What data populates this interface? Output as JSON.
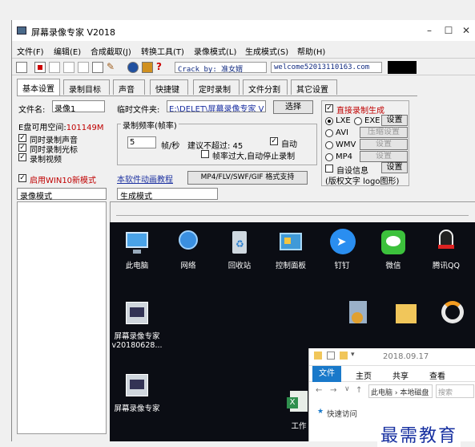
{
  "window": {
    "title": "屏幕录像专家 V2018"
  },
  "menu": [
    "文件(F)",
    "编辑(E)",
    "合成截取(J)",
    "转换工具(T)",
    "录像模式(L)",
    "生成模式(S)",
    "帮助(H)"
  ],
  "toolbar": {
    "crack_text": "Crack by: 准女婿",
    "email_text": "welcome52013110163.com"
  },
  "tabs": [
    "基本设置",
    "录制目标",
    "声音",
    "快捷键",
    "定时录制",
    "文件分割",
    "其它设置"
  ],
  "basic": {
    "filename_label": "文件名:",
    "filename_value": "录像1",
    "tempdir_label": "临时文件夹:",
    "tempdir_value": "E:\\DELET\\屏幕录像专家 V",
    "select_button": "选择",
    "free_space_label": "E盘可用空间:",
    "free_space_value": "101149M",
    "checks": [
      "同时录制声音",
      "同时录制光标",
      "录制视频"
    ],
    "win10_mode": "启用WIN10新模式",
    "tutorial_link": "本软件动画教程",
    "format_button": "MP4/FLV/SWF/GIF  格式支持"
  },
  "frequency": {
    "group_title": "录制频率(帧率)",
    "fps_value": "5",
    "fps_unit": "帧/秒",
    "suggest_text": "建议不超过: 45",
    "auto_label": "自动",
    "auto_stop_label": "帧率过大,自动停止录制"
  },
  "generate": {
    "direct_label": "直接录制生成",
    "formats": [
      {
        "label": "LXE",
        "alt": "EXE",
        "button": "设置",
        "dim": false
      },
      {
        "label": "AVI",
        "button": "压缩设置",
        "dim": true
      },
      {
        "label": "WMV",
        "button": "设置",
        "dim": true
      },
      {
        "label": "MP4",
        "button": "设置",
        "dim": true
      }
    ],
    "auto_info_label": "自设信息",
    "auto_info_button": "设置",
    "copyright_text": "(版权文字 logo图形)"
  },
  "modes": {
    "record_mode": "录像模式",
    "generate_mode": "生成模式"
  },
  "desktop_icons": [
    {
      "label": "此电脑",
      "icon": "computer-icon",
      "color": "#4aa3e8"
    },
    {
      "label": "网络",
      "icon": "network-icon",
      "color": "#3a8fe0"
    },
    {
      "label": "回收站",
      "icon": "recycle-bin-icon",
      "color": "#cfd8e0"
    },
    {
      "label": "控制面板",
      "icon": "control-panel-icon",
      "color": "#3f9ad8"
    },
    {
      "label": "钉钉",
      "icon": "dingtalk-icon",
      "color": "#2a8ef0"
    },
    {
      "label": "微信",
      "icon": "wechat-icon",
      "color": "#3cc13c"
    },
    {
      "label": "腾讯QQ",
      "icon": "qq-icon",
      "color": "#f2f2f2"
    }
  ],
  "desktop_icons_row2": [
    {
      "label": "屏幕录像专家\nv20180628...",
      "icon": "recorder-app-icon",
      "color": "#d0d6dd"
    },
    {
      "label": "屏幕录像专家",
      "icon": "recorder-app-icon",
      "color": "#d0d6dd"
    },
    {
      "label": "工作",
      "icon": "excel-icon",
      "color": "#2f8f4e"
    }
  ],
  "explorer": {
    "title_date": "2018.09.17",
    "ribbon_tabs": [
      "文件",
      "主页",
      "共享",
      "查看"
    ],
    "breadcrumb": "此电脑 › 本地磁盘",
    "quick_access": "快速访问",
    "search_placeholder": "搜索"
  },
  "watermark": "最需教育"
}
